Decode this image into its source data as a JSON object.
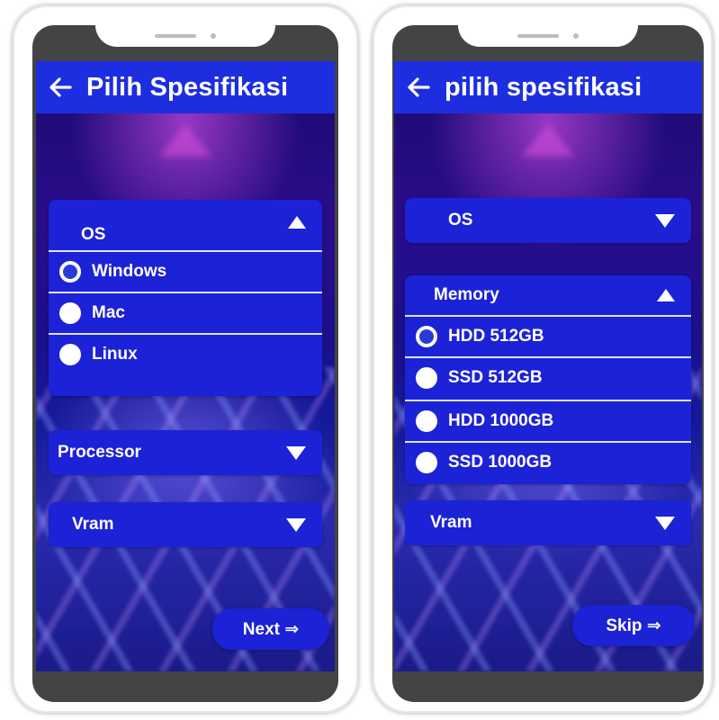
{
  "left_screen": {
    "title": "Pilih Spesifikasi",
    "os_section": {
      "label": "OS",
      "options": [
        {
          "label": "Windows",
          "selected": true
        },
        {
          "label": "Mac",
          "selected": false
        },
        {
          "label": "Linux",
          "selected": false
        }
      ]
    },
    "processor_label": "Processor",
    "vram_label": "Vram",
    "next_label": "Next ⇒"
  },
  "right_screen": {
    "title": "pilih spesifikasi",
    "os_label": "OS",
    "memory_section": {
      "label": "Memory",
      "options": [
        {
          "label": "HDD 512GB",
          "selected": true
        },
        {
          "label": "SSD 512GB",
          "selected": false
        },
        {
          "label": "HDD 1000GB",
          "selected": false
        },
        {
          "label": "SSD 1000GB",
          "selected": false
        }
      ]
    },
    "vram_label": "Vram",
    "skip_label": "Skip ⇒"
  },
  "colors": {
    "app_bar": "#1d2ee0",
    "card": "#1c22d6",
    "text": "#ffffff"
  }
}
